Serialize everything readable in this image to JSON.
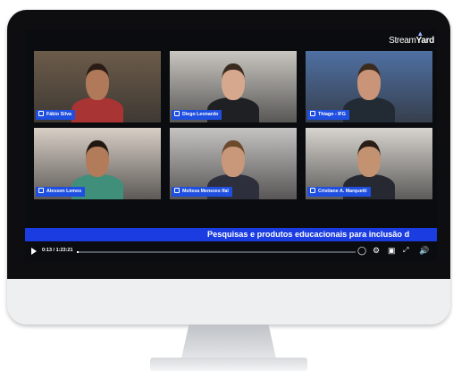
{
  "brand": {
    "prefix": "Stream",
    "suffix": "Yard"
  },
  "participants": [
    {
      "name": "Fábio Silva",
      "bg": "#6c5c4a",
      "skin": "#b07a5a",
      "shirt": "#a93434",
      "hair": "#2a1c14"
    },
    {
      "name": "Diego Leonardo",
      "bg": "#c9c6c1",
      "skin": "#d6a98f",
      "shirt": "#1e2024",
      "hair": "#3a2b20"
    },
    {
      "name": "Thiago - IFG",
      "bg": "#4f70a3",
      "skin": "#c99478",
      "shirt": "#222a34",
      "hair": "#3b2a1e"
    },
    {
      "name": "Alesson Lemos",
      "bg": "#d8cfc6",
      "skin": "#b27b5a",
      "shirt": "#3f8f7a",
      "hair": "#221710"
    },
    {
      "name": "Melissa Menezes Ifal",
      "bg": "#c5c2c2",
      "skin": "#c99779",
      "shirt": "#2d2f3c",
      "hair": "#6b4a2c"
    },
    {
      "name": "Cristiane A. Marquetti",
      "bg": "#d7d4cf",
      "skin": "#c29271",
      "shirt": "#262832",
      "hair": "#2a1d16"
    }
  ],
  "ticker": "Pesquisas e produtos educacionais para inclusão d",
  "player": {
    "time": "0:13 / 1:23:21",
    "progress": 0.005
  }
}
